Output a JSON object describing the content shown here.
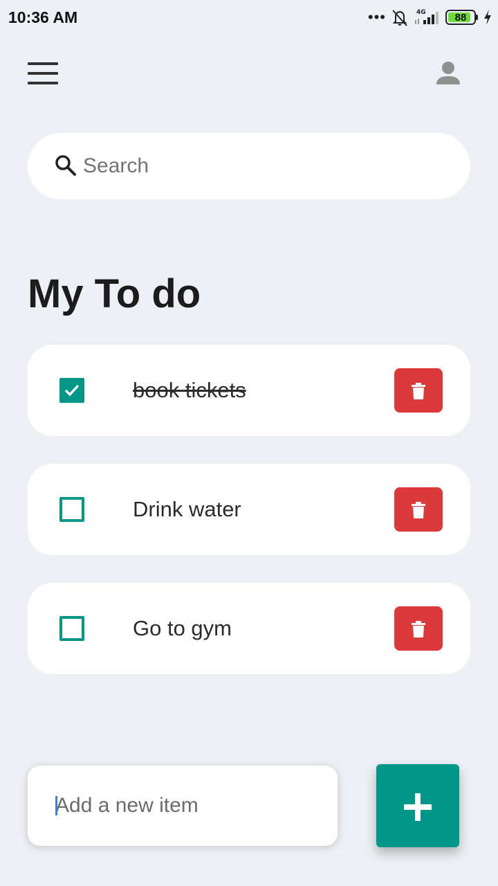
{
  "status_bar": {
    "time": "10:36 AM",
    "network": "4G",
    "battery_level": "88"
  },
  "header": {
    "menu_icon": "menu-icon",
    "profile_icon": "person-icon"
  },
  "search": {
    "placeholder": "Search",
    "value": "",
    "icon": "search-icon"
  },
  "main": {
    "title": "My To do",
    "todos": [
      {
        "text": "book tickets",
        "done": true
      },
      {
        "text": "Drink water",
        "done": false
      },
      {
        "text": "Go to gym",
        "done": false
      }
    ]
  },
  "add_item": {
    "placeholder": "Add a new item",
    "value": "",
    "button_icon": "plus-icon"
  },
  "colors": {
    "background": "#eef0f5",
    "accent": "#009688",
    "delete": "#dc3a3a",
    "card": "#ffffff"
  }
}
